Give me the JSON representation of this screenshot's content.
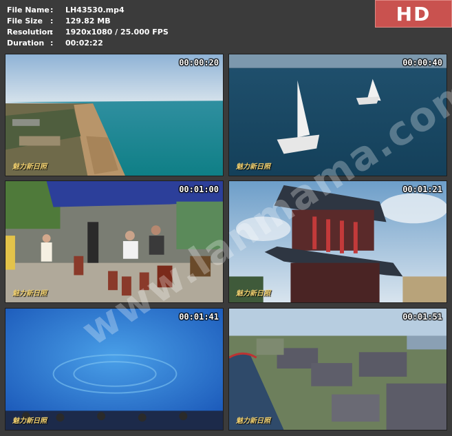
{
  "meta": {
    "file_name_label": "File Name",
    "file_name": "LH43530.mp4",
    "file_size_label": "File Size",
    "file_size": "129.82 MB",
    "resolution_label": "Resolution",
    "resolution": "1920x1080 / 25.000 FPS",
    "duration_label": "Duration",
    "duration": "00:02:22",
    "separator": ":"
  },
  "badge": "HD",
  "thumbnails": [
    {
      "time": "00:00:20",
      "scene": "beach-aerial",
      "logo": "魅力新日照"
    },
    {
      "time": "00:00:40",
      "scene": "sailboat-sea",
      "logo": "魅力新日照"
    },
    {
      "time": "00:01:00",
      "scene": "drummers-tent",
      "logo": "魅力新日照"
    },
    {
      "time": "00:01:21",
      "scene": "pagoda-tower",
      "logo": "魅力新日照"
    },
    {
      "time": "00:01:41",
      "scene": "aquarium-tank",
      "logo": "魅力新日照"
    },
    {
      "time": "00:01:51",
      "scene": "villas-canal",
      "logo": "魅力新日照"
    }
  ],
  "watermark": "www.lanmama.com"
}
